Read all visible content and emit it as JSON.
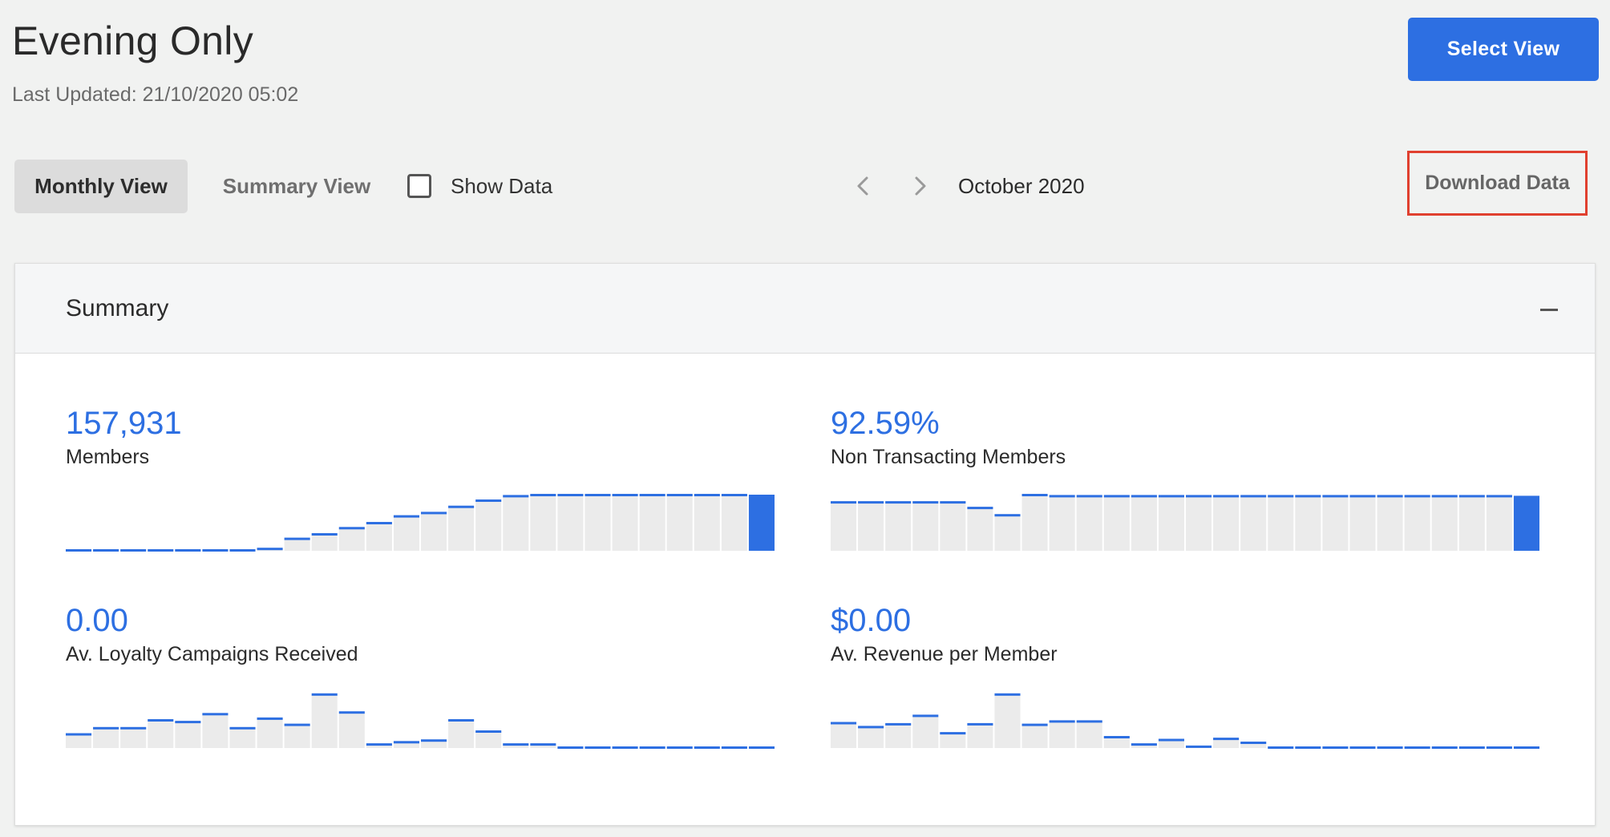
{
  "header": {
    "title": "Evening Only",
    "last_updated": "Last Updated: 21/10/2020 05:02",
    "select_view_label": "Select View"
  },
  "toolbar": {
    "tabs": [
      {
        "label": "Monthly View",
        "active": true
      },
      {
        "label": "Summary View",
        "active": false
      }
    ],
    "show_data_label": "Show Data",
    "show_data_checked": false,
    "month": "October 2020",
    "download_label": "Download Data"
  },
  "summary": {
    "title": "Summary",
    "metrics": [
      {
        "value": "157,931",
        "label": "Members"
      },
      {
        "value": "92.59%",
        "label": "Non Transacting Members"
      },
      {
        "value": "0.00",
        "label": "Av. Loyalty Campaigns Received"
      },
      {
        "value": "$0.00",
        "label": "Av. Revenue per Member"
      }
    ]
  },
  "colors": {
    "accent": "#2d6fe2",
    "bar_fill": "#ebebeb",
    "highlight_border": "#e0402f"
  },
  "chart_data": [
    {
      "type": "bar",
      "series": [
        {
          "values": [
            0,
            0,
            0,
            0,
            0,
            0,
            0,
            0.04,
            0.22,
            0.3,
            0.41,
            0.5,
            0.62,
            0.68,
            0.79,
            0.9,
            0.98,
            1,
            1,
            1,
            1,
            1,
            1,
            1,
            1,
            1
          ]
        }
      ],
      "highlight_last": true
    },
    {
      "type": "bar",
      "series": [
        {
          "values": [
            0.87,
            0.87,
            0.87,
            0.87,
            0.87,
            0.77,
            0.64,
            1,
            0.98,
            0.98,
            0.98,
            0.98,
            0.98,
            0.98,
            0.98,
            0.98,
            0.98,
            0.98,
            0.98,
            0.98,
            0.98,
            0.98,
            0.98,
            0.98,
            0.98,
            0.98
          ]
        }
      ],
      "highlight_last": true
    },
    {
      "type": "bar",
      "series": [
        {
          "values": [
            0.25,
            0.36,
            0.36,
            0.5,
            0.47,
            0.61,
            0.36,
            0.53,
            0.42,
            0.96,
            0.64,
            0.07,
            0.11,
            0.14,
            0.5,
            0.3,
            0.07,
            0.07,
            0,
            0,
            0,
            0,
            0,
            0,
            0,
            0
          ]
        }
      ],
      "highlight_last": false
    },
    {
      "type": "bar",
      "series": [
        {
          "values": [
            0.45,
            0.38,
            0.43,
            0.58,
            0.27,
            0.43,
            0.96,
            0.42,
            0.48,
            0.48,
            0.2,
            0.07,
            0.15,
            0.03,
            0.17,
            0.1,
            0,
            0,
            0,
            0,
            0,
            0,
            0,
            0,
            0,
            0
          ]
        }
      ],
      "highlight_last": false
    }
  ]
}
